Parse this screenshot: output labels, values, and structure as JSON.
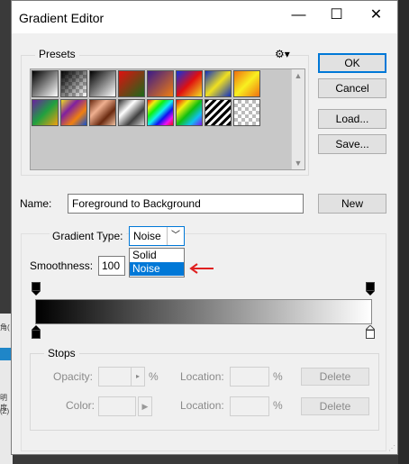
{
  "window": {
    "title": "Gradient Editor",
    "minimize_label": "—",
    "maximize_label": "☐",
    "close_label": "✕"
  },
  "presets": {
    "group_label": "Presets",
    "menu_icon": "gear-icon",
    "swatches_row1": [
      "fg-to-bg",
      "fg-to-transparent",
      "black-white",
      "red-green",
      "violet-orange",
      "blue-red-yellow",
      "blue-yellow-blue",
      "orange-yellow-orange"
    ],
    "swatches_row2": [
      "violet-green-orange",
      "yellow-violet-orange-blue",
      "copper",
      "chrome",
      "spectrum",
      "transparent-rainbow",
      "transparent-stripes",
      "transparent"
    ]
  },
  "buttons": {
    "ok": "OK",
    "cancel": "Cancel",
    "load": "Load...",
    "save": "Save...",
    "new": "New"
  },
  "name_field": {
    "label": "Name:",
    "value": "Foreground to Background"
  },
  "gradient_type": {
    "label": "Gradient Type:",
    "selected": "Noise",
    "options": [
      "Solid",
      "Noise"
    ]
  },
  "smoothness": {
    "label": "Smoothness:",
    "value": "100"
  },
  "stops": {
    "group_label": "Stops",
    "opacity_label": "Opacity:",
    "opacity_unit": "%",
    "color_label": "Color:",
    "location_label_1": "Location:",
    "location_unit_1": "%",
    "location_label_2": "Location:",
    "location_unit_2": "%",
    "delete_1": "Delete",
    "delete_2": "Delete"
  },
  "background_app": {
    "left_strip_text_1": "角(",
    "left_strip_text_2": "明度",
    "left_strip_text_3": "(Z)"
  },
  "colors": {
    "accent": "#0078d7",
    "annotation_arrow": "#e02020"
  }
}
